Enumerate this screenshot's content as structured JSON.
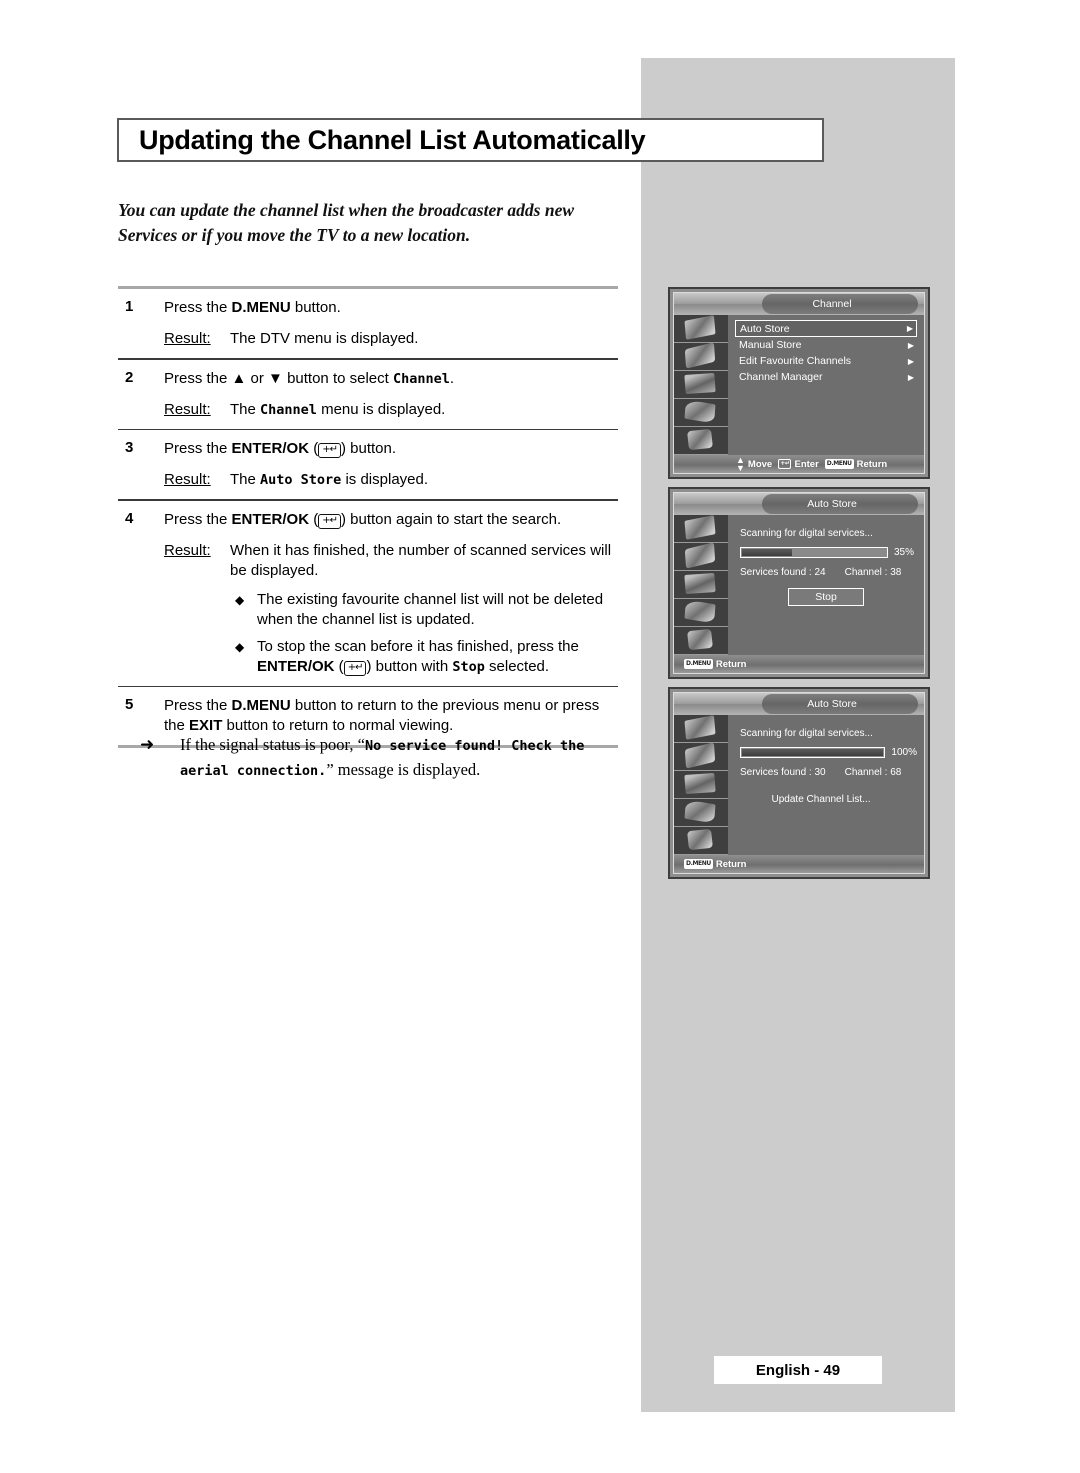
{
  "page": {
    "title": "Updating the Channel List Automatically",
    "intro_line1": "You can update the channel list when the broadcaster adds new",
    "intro_line2": "Services or if you move the TV to a new location.",
    "footer": "English - 49"
  },
  "steps": [
    {
      "num": "1",
      "instruction_pre": "Press the ",
      "instruction_key": "D.MENU",
      "instruction_post": " button.",
      "result_label": "Result:",
      "result_text": "The DTV menu is displayed."
    },
    {
      "num": "2",
      "instruction_pre": "Press the ",
      "instruction_key": "▲ or ▼",
      "instruction_post": " button to select ",
      "instruction_mono": "Channel",
      "instruction_end": ".",
      "result_label": "Result:",
      "result_pre": "The ",
      "result_mono": "Channel",
      "result_post": " menu is displayed."
    },
    {
      "num": "3",
      "instruction_pre": "Press the ",
      "instruction_key": "ENTER/OK",
      "instruction_post": " button.",
      "result_label": "Result:",
      "result_pre": "The ",
      "result_mono": "Auto Store",
      "result_post": " is displayed."
    },
    {
      "num": "4",
      "instruction_pre": "Press the ",
      "instruction_key": "ENTER/OK",
      "instruction_post": " button again to start the search.",
      "result_label": "Result:",
      "result_text": "When it has finished, the number of scanned services will be displayed.",
      "bullets": [
        {
          "glyph": "◆",
          "text": "The existing favourite channel list will not be deleted when the channel list is updated."
        },
        {
          "glyph": "◆",
          "text_pre": "To stop the scan before it has finished, press the ",
          "text_key": "ENTER/OK",
          "text_mid": " button with ",
          "text_mono": "Stop",
          "text_post": " selected."
        }
      ]
    },
    {
      "num": "5",
      "instruction_pre": "Press the ",
      "instruction_key": "D.MENU",
      "instruction_mid": " button to return to the previous menu or press the ",
      "instruction_key2": "EXIT",
      "instruction_post": " button to return to normal viewing."
    }
  ],
  "note": {
    "glyph": "➜",
    "text_pre": "If the signal status is poor, “",
    "text_mono1": "No service found! Check the",
    "text_mono2": "aerial connection.",
    "text_post": "” message is displayed."
  },
  "osd_screens": [
    {
      "id": "channel-menu",
      "title": "Channel",
      "menu_items": [
        {
          "label": "Auto Store",
          "arrow": "▶",
          "selected": true
        },
        {
          "label": "Manual Store",
          "arrow": "▶",
          "selected": false
        },
        {
          "label": "Edit Favourite Channels",
          "arrow": "▶",
          "selected": false
        },
        {
          "label": "Channel Manager",
          "arrow": "▶",
          "selected": false
        }
      ],
      "status": [
        {
          "key": "▲▼",
          "label": "Move"
        },
        {
          "key": "ENTER",
          "label": "Enter"
        },
        {
          "key": "D.MENU",
          "label": "Return"
        }
      ]
    },
    {
      "id": "auto-store-scanning",
      "title": "Auto Store",
      "scan_text": "Scanning for digital services...",
      "progress_pct_label": "35%",
      "progress_value": 35,
      "services_found": "Services found : 24",
      "channel": "Channel : 38",
      "stop_button": "Stop",
      "status": [
        {
          "key": "D.MENU",
          "label": "Return"
        }
      ]
    },
    {
      "id": "auto-store-complete",
      "title": "Auto Store",
      "scan_text": "Scanning for digital services...",
      "progress_pct_label": "100%",
      "progress_value": 100,
      "services_found": "Services found : 30",
      "channel": "Channel : 68",
      "update_text": "Update Channel List...",
      "status": [
        {
          "key": "D.MENU",
          "label": "Return"
        }
      ]
    }
  ],
  "colors": {
    "panel_grey": "#cccccc",
    "osd_body": "#6e6e6e",
    "osd_border": "#3d3d3d",
    "rule_light": "#a8a8a8",
    "rule_dark": "#3a3a3a"
  }
}
